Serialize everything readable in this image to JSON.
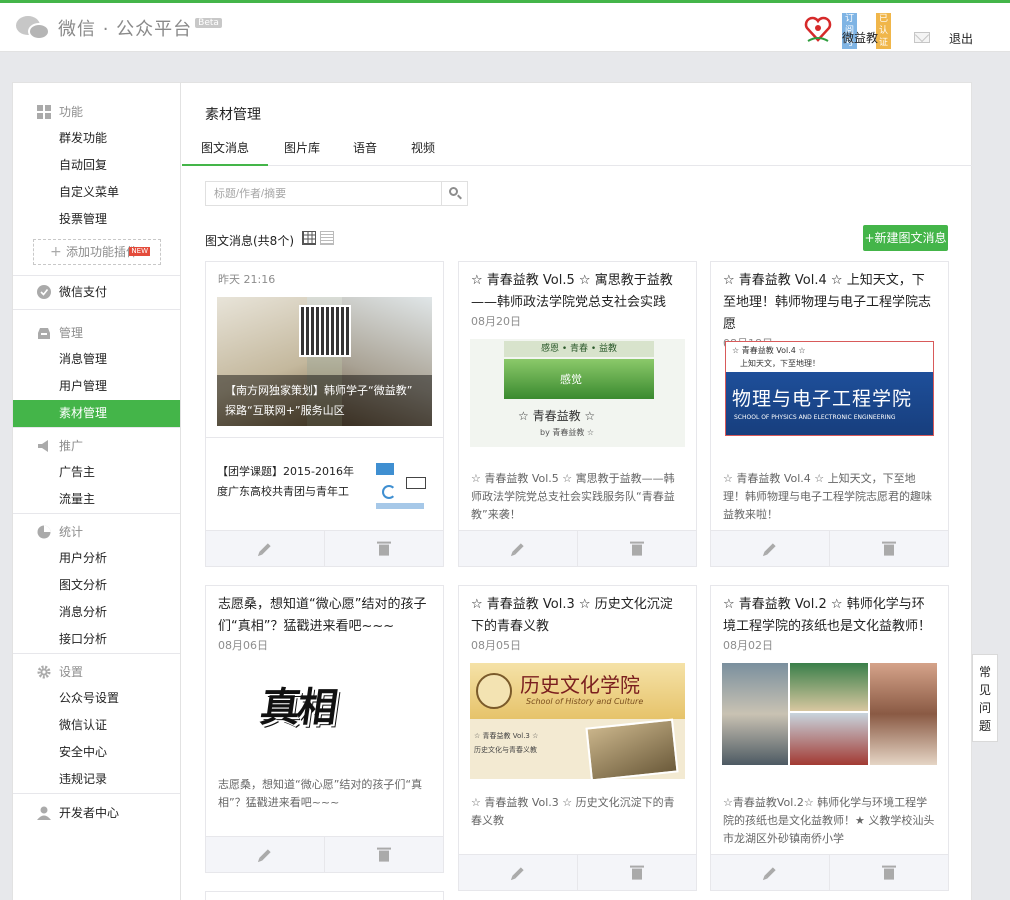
{
  "brand": {
    "title": "微信 · 公众平台",
    "beta": "Beta"
  },
  "account": {
    "name": "微益教",
    "badge_subscription": "订阅号",
    "badge_verified": "已认证",
    "logout": "退出"
  },
  "sidebar": {
    "groups": [
      {
        "head": "功能",
        "icon": "grid-icon",
        "items": [
          "群发功能",
          "自动回复",
          "自定义菜单",
          "投票管理"
        ],
        "add_plugin": "添加功能插件",
        "new_badge": "NEW"
      },
      {
        "head": "微信支付",
        "icon": "pay-icon",
        "items": []
      },
      {
        "head": "管理",
        "icon": "tray-icon",
        "items": [
          "消息管理",
          "用户管理",
          "素材管理"
        ]
      },
      {
        "head": "推广",
        "icon": "megaphone-icon",
        "items": [
          "广告主",
          "流量主"
        ]
      },
      {
        "head": "统计",
        "icon": "pie-icon",
        "items": [
          "用户分析",
          "图文分析",
          "消息分析",
          "接口分析"
        ]
      },
      {
        "head": "设置",
        "icon": "gear-icon",
        "items": [
          "公众号设置",
          "微信认证",
          "安全中心",
          "违规记录"
        ]
      },
      {
        "head": "开发者中心",
        "icon": "user-icon",
        "items": []
      }
    ],
    "active": "素材管理"
  },
  "main": {
    "title": "素材管理",
    "tabs": [
      "图文消息",
      "图片库",
      "语音",
      "视频"
    ],
    "active_tab": "图文消息",
    "search_placeholder": "标题/作者/摘要",
    "count_label": "图文消息(共8个)",
    "new_button": "+新建图文消息"
  },
  "cards": [
    {
      "date": "昨天 21:16",
      "cover_caption": "【南方网独家策划】韩师学子“微益教” 探路“互联网+”服务山区",
      "sub_title": "【团学课题】2015-2016年度广东高校共青团与青年工"
    },
    {
      "title": "☆ 青春益教 Vol.5 ☆ 寓思教于益教——韩师政法学院党总支社会实践",
      "date": "08月20日",
      "desc": "☆ 青春益教 Vol.5 ☆ 寓思教于益教——韩师政法学院党总支社会实践服务队“青春益教”来袭！",
      "thumb_text": "☆ 青春益教 ☆",
      "thumb_word": "感觉",
      "thumb_sub": "by 青春益教 ☆"
    },
    {
      "title": "☆ 青春益教 Vol.4 ☆ 上知天文，下至地理！韩师物理与电子工程学院志愿",
      "date": "08月18日",
      "desc": "☆ 青春益教 Vol.4 ☆ 上知天文，下至地理！韩师物理与电子工程学院志愿君的趣味益教来啦！",
      "thumb_line1": "☆ 青春益教 Vol.4 ☆",
      "thumb_line2": "上知天文，下至地理！",
      "thumb_big": "物理与电子工程学院",
      "thumb_en": "SCHOOL OF PHYSICS AND ELECTRONIC ENGINEERING"
    },
    {
      "title": "志愿桑，想知道“微心愿”结对的孩子们“真相”？猛戳进来看吧~~~",
      "date": "08月06日",
      "desc": "志愿桑，想知道“微心愿”结对的孩子们“真相”？猛戳进来看吧~~~",
      "thumb_text": "真相"
    },
    {
      "title": "☆ 青春益教 Vol.3 ☆ 历史文化沉淀下的青春义教",
      "date": "08月05日",
      "desc": "☆ 青春益教 Vol.3 ☆ 历史文化沉淀下的青春义教",
      "thumb_big": "历史文化学院",
      "thumb_en": "School of History and Culture",
      "thumb_line1": "☆ 青春益教 Vol.3 ☆",
      "thumb_line2": "历史文化与青春义教"
    },
    {
      "title": "☆ 青春益教 Vol.2 ☆ 韩师化学与环境工程学院的孩纸也是文化益教师！",
      "date": "08月02日",
      "desc": "☆青春益教Vol.2☆ 韩师化学与环境工程学院的孩纸也是文化益教师！★ 义教学校汕头市龙湖区外砂镇南侨小学"
    }
  ],
  "help_tab": "常见问题"
}
